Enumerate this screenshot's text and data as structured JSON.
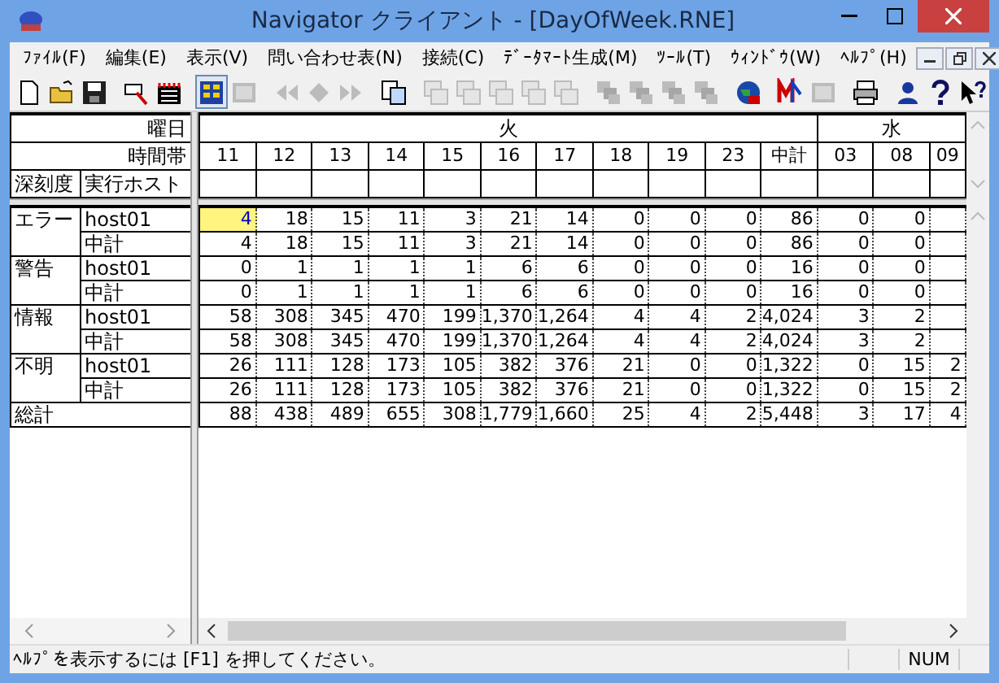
{
  "window": {
    "title": "Navigator クライアント - [DayOfWeek.RNE]"
  },
  "menu": [
    "ﾌｧｲﾙ(F)",
    "編集(E)",
    "表示(V)",
    "問い合わせ表(N)",
    "接続(C)",
    "ﾃﾞｰﾀﾏｰﾄ生成(M)",
    "ﾂｰﾙ(T)",
    "ｳｨﾝﾄﾞｳ(W)",
    "ﾍﾙﾌﾟ(H)"
  ],
  "toolbar": [
    {
      "kind": "button",
      "disabled": false,
      "pressed": false
    },
    {
      "kind": "button",
      "disabled": false,
      "pressed": false
    },
    {
      "kind": "button",
      "disabled": false,
      "pressed": false
    },
    {
      "kind": "separator"
    },
    {
      "kind": "button",
      "disabled": false,
      "pressed": false
    },
    {
      "kind": "button",
      "disabled": false,
      "pressed": false
    },
    {
      "kind": "separator"
    },
    {
      "kind": "button",
      "disabled": false,
      "pressed": true
    },
    {
      "kind": "button",
      "disabled": true,
      "pressed": false
    },
    {
      "kind": "separator"
    },
    {
      "kind": "button",
      "disabled": true,
      "pressed": false
    },
    {
      "kind": "button",
      "disabled": true,
      "pressed": false
    },
    {
      "kind": "button",
      "disabled": true,
      "pressed": false
    },
    {
      "kind": "separator"
    },
    {
      "kind": "button",
      "disabled": false,
      "pressed": false
    },
    {
      "kind": "separator"
    },
    {
      "kind": "button",
      "disabled": true,
      "pressed": false
    },
    {
      "kind": "button",
      "disabled": true,
      "pressed": false
    },
    {
      "kind": "button",
      "disabled": true,
      "pressed": false
    },
    {
      "kind": "button",
      "disabled": true,
      "pressed": false
    },
    {
      "kind": "button",
      "disabled": true,
      "pressed": false
    },
    {
      "kind": "separator"
    },
    {
      "kind": "button",
      "disabled": true,
      "pressed": false
    },
    {
      "kind": "button",
      "disabled": true,
      "pressed": false
    },
    {
      "kind": "button",
      "disabled": true,
      "pressed": false
    },
    {
      "kind": "button",
      "disabled": true,
      "pressed": false
    },
    {
      "kind": "separator"
    },
    {
      "kind": "button",
      "disabled": false,
      "pressed": false
    },
    {
      "kind": "separator"
    },
    {
      "kind": "button",
      "disabled": false,
      "pressed": false
    },
    {
      "kind": "button",
      "disabled": true,
      "pressed": false
    },
    {
      "kind": "separator"
    },
    {
      "kind": "button",
      "disabled": false,
      "pressed": false
    },
    {
      "kind": "separator"
    },
    {
      "kind": "button",
      "disabled": false,
      "pressed": false
    },
    {
      "kind": "button",
      "disabled": false,
      "pressed": false
    },
    {
      "kind": "button",
      "disabled": false,
      "pressed": false
    }
  ],
  "row_header": {
    "day_label": "曜日",
    "hour_label": "時間帯",
    "columns": [
      "深刻度",
      "実行ホスト"
    ]
  },
  "days": [
    {
      "label": "火",
      "hours": [
        "11",
        "12",
        "13",
        "14",
        "15",
        "16",
        "17",
        "18",
        "19",
        "23",
        "中計"
      ]
    },
    {
      "label": "水",
      "hours": [
        "03",
        "08",
        "09"
      ]
    }
  ],
  "groups": [
    {
      "severity": "エラー",
      "rows": [
        {
          "host": "host01",
          "cells": [
            {
              "text": "4",
              "selected": true
            },
            {
              "text": "18",
              "selected": false
            },
            {
              "text": "15",
              "selected": false
            },
            {
              "text": "11",
              "selected": false
            },
            {
              "text": "3",
              "selected": false
            },
            {
              "text": "21",
              "selected": false
            },
            {
              "text": "14",
              "selected": false
            },
            {
              "text": "0",
              "selected": false
            },
            {
              "text": "0",
              "selected": false
            },
            {
              "text": "0",
              "selected": false
            },
            {
              "text": "86",
              "selected": false
            },
            {
              "text": "0",
              "selected": false
            },
            {
              "text": "0",
              "selected": false
            },
            null
          ]
        },
        {
          "host": "中計",
          "cells": [
            {
              "text": "4",
              "selected": false
            },
            {
              "text": "18",
              "selected": false
            },
            {
              "text": "15",
              "selected": false
            },
            {
              "text": "11",
              "selected": false
            },
            {
              "text": "3",
              "selected": false
            },
            {
              "text": "21",
              "selected": false
            },
            {
              "text": "14",
              "selected": false
            },
            {
              "text": "0",
              "selected": false
            },
            {
              "text": "0",
              "selected": false
            },
            {
              "text": "0",
              "selected": false
            },
            {
              "text": "86",
              "selected": false
            },
            {
              "text": "0",
              "selected": false
            },
            {
              "text": "0",
              "selected": false
            },
            null
          ]
        }
      ]
    },
    {
      "severity": "警告",
      "rows": [
        {
          "host": "host01",
          "cells": [
            {
              "text": "0",
              "selected": false
            },
            {
              "text": "1",
              "selected": false
            },
            {
              "text": "1",
              "selected": false
            },
            {
              "text": "1",
              "selected": false
            },
            {
              "text": "1",
              "selected": false
            },
            {
              "text": "6",
              "selected": false
            },
            {
              "text": "6",
              "selected": false
            },
            {
              "text": "0",
              "selected": false
            },
            {
              "text": "0",
              "selected": false
            },
            {
              "text": "0",
              "selected": false
            },
            {
              "text": "16",
              "selected": false
            },
            {
              "text": "0",
              "selected": false
            },
            {
              "text": "0",
              "selected": false
            },
            null
          ]
        },
        {
          "host": "中計",
          "cells": [
            {
              "text": "0",
              "selected": false
            },
            {
              "text": "1",
              "selected": false
            },
            {
              "text": "1",
              "selected": false
            },
            {
              "text": "1",
              "selected": false
            },
            {
              "text": "1",
              "selected": false
            },
            {
              "text": "6",
              "selected": false
            },
            {
              "text": "6",
              "selected": false
            },
            {
              "text": "0",
              "selected": false
            },
            {
              "text": "0",
              "selected": false
            },
            {
              "text": "0",
              "selected": false
            },
            {
              "text": "16",
              "selected": false
            },
            {
              "text": "0",
              "selected": false
            },
            {
              "text": "0",
              "selected": false
            },
            null
          ]
        }
      ]
    },
    {
      "severity": "情報",
      "rows": [
        {
          "host": "host01",
          "cells": [
            {
              "text": "58",
              "selected": false
            },
            {
              "text": "308",
              "selected": false
            },
            {
              "text": "345",
              "selected": false
            },
            {
              "text": "470",
              "selected": false
            },
            {
              "text": "199",
              "selected": false
            },
            {
              "text": "1,370",
              "selected": false
            },
            {
              "text": "1,264",
              "selected": false
            },
            {
              "text": "4",
              "selected": false
            },
            {
              "text": "4",
              "selected": false
            },
            {
              "text": "2",
              "selected": false
            },
            {
              "text": "4,024",
              "selected": false
            },
            {
              "text": "3",
              "selected": false
            },
            {
              "text": "2",
              "selected": false
            },
            null
          ]
        },
        {
          "host": "中計",
          "cells": [
            {
              "text": "58",
              "selected": false
            },
            {
              "text": "308",
              "selected": false
            },
            {
              "text": "345",
              "selected": false
            },
            {
              "text": "470",
              "selected": false
            },
            {
              "text": "199",
              "selected": false
            },
            {
              "text": "1,370",
              "selected": false
            },
            {
              "text": "1,264",
              "selected": false
            },
            {
              "text": "4",
              "selected": false
            },
            {
              "text": "4",
              "selected": false
            },
            {
              "text": "2",
              "selected": false
            },
            {
              "text": "4,024",
              "selected": false
            },
            {
              "text": "3",
              "selected": false
            },
            {
              "text": "2",
              "selected": false
            },
            null
          ]
        }
      ]
    },
    {
      "severity": "不明",
      "rows": [
        {
          "host": "host01",
          "cells": [
            {
              "text": "26",
              "selected": false
            },
            {
              "text": "111",
              "selected": false
            },
            {
              "text": "128",
              "selected": false
            },
            {
              "text": "173",
              "selected": false
            },
            {
              "text": "105",
              "selected": false
            },
            {
              "text": "382",
              "selected": false
            },
            {
              "text": "376",
              "selected": false
            },
            {
              "text": "21",
              "selected": false
            },
            {
              "text": "0",
              "selected": false
            },
            {
              "text": "0",
              "selected": false
            },
            {
              "text": "1,322",
              "selected": false
            },
            {
              "text": "0",
              "selected": false
            },
            {
              "text": "15",
              "selected": false
            },
            {
              "text": "2",
              "selected": false
            }
          ]
        },
        {
          "host": "中計",
          "cells": [
            {
              "text": "26",
              "selected": false
            },
            {
              "text": "111",
              "selected": false
            },
            {
              "text": "128",
              "selected": false
            },
            {
              "text": "173",
              "selected": false
            },
            {
              "text": "105",
              "selected": false
            },
            {
              "text": "382",
              "selected": false
            },
            {
              "text": "376",
              "selected": false
            },
            {
              "text": "21",
              "selected": false
            },
            {
              "text": "0",
              "selected": false
            },
            {
              "text": "0",
              "selected": false
            },
            {
              "text": "1,322",
              "selected": false
            },
            {
              "text": "0",
              "selected": false
            },
            {
              "text": "15",
              "selected": false
            },
            {
              "text": "2",
              "selected": false
            }
          ]
        }
      ]
    }
  ],
  "total": {
    "label": "総計",
    "cells": [
      {
        "text": "88",
        "selected": false
      },
      {
        "text": "438",
        "selected": false
      },
      {
        "text": "489",
        "selected": false
      },
      {
        "text": "655",
        "selected": false
      },
      {
        "text": "308",
        "selected": false
      },
      {
        "text": "1,779",
        "selected": false
      },
      {
        "text": "1,660",
        "selected": false
      },
      {
        "text": "25",
        "selected": false
      },
      {
        "text": "4",
        "selected": false
      },
      {
        "text": "2",
        "selected": false
      },
      {
        "text": "5,448",
        "selected": false
      },
      {
        "text": "3",
        "selected": false
      },
      {
        "text": "17",
        "selected": false
      },
      {
        "text": "4",
        "selected": false
      }
    ]
  },
  "status_bar": {
    "message": "ﾍﾙﾌﾟを表示するには [F1] を押してください。",
    "indicator": "NUM"
  }
}
